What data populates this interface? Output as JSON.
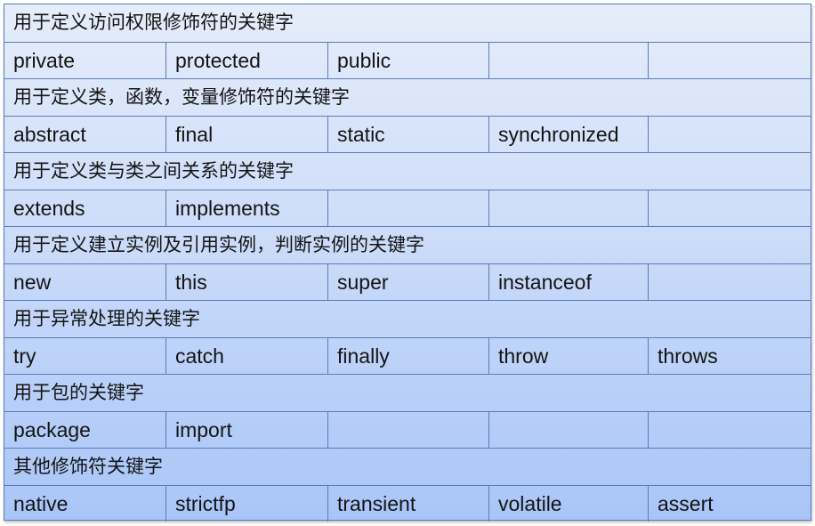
{
  "groups": [
    {
      "title": "用于定义访问权限修饰符的关键字",
      "keywords": [
        "private",
        "protected",
        "public",
        "",
        ""
      ]
    },
    {
      "title": "用于定义类，函数，变量修饰符的关键字",
      "keywords": [
        "abstract",
        "final",
        "static",
        "synchronized",
        ""
      ]
    },
    {
      "title": "用于定义类与类之间关系的关键字",
      "keywords": [
        "extends",
        "implements",
        "",
        "",
        ""
      ]
    },
    {
      "title": "用于定义建立实例及引用实例，判断实例的关键字",
      "keywords": [
        "new",
        "this",
        "super",
        "instanceof",
        ""
      ]
    },
    {
      "title": "用于异常处理的关键字",
      "keywords": [
        "try",
        "catch",
        "finally",
        "throw",
        "throws"
      ]
    },
    {
      "title": "用于包的关键字",
      "keywords": [
        "package",
        "import",
        "",
        "",
        ""
      ]
    },
    {
      "title": "其他修饰符关键字",
      "keywords": [
        "native",
        "strictfp",
        "transient",
        "volatile",
        "assert"
      ]
    }
  ],
  "colors": {
    "border": "#5a7cb8",
    "gradient_top": "#e6edfa",
    "gradient_bottom": "#a9c5f8"
  }
}
